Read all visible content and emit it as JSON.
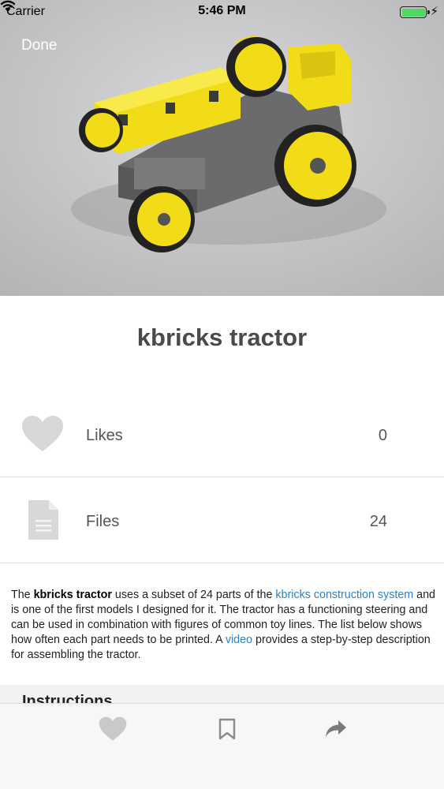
{
  "status_bar": {
    "carrier": "Carrier",
    "time": "5:46 PM",
    "battery_level": 1.0,
    "charging_icon": "bolt-icon"
  },
  "nav": {
    "done_label": "Done"
  },
  "hero": {
    "image": "yellow-gray-toy-tractor-photo"
  },
  "title": "kbricks tractor",
  "stats": [
    {
      "icon": "heart-icon",
      "label": "Likes",
      "value": "0"
    },
    {
      "icon": "document-icon",
      "label": "Files",
      "value": "24"
    }
  ],
  "description": {
    "p1": "The ",
    "bold": "kbricks tractor",
    "p2": " uses a subset of 24 parts of the  ",
    "link1": "kbricks construction system",
    "p3": " and is one of the first models I designed for it. The tractor has a functioning steering and can be used in combination with figures of common toy lines. The list below shows how often each part needs to be printed. A ",
    "link2": "video",
    "p4": " provides a step-by-step description for assembling the tractor."
  },
  "section_heading": "Instructions",
  "toolbar": {
    "items": [
      "heart-icon",
      "bookmark-icon",
      "share-icon"
    ]
  },
  "colors": {
    "link": "#2a83c6",
    "accent_yellow": "#f4e01e",
    "battery": "#4cd964"
  }
}
